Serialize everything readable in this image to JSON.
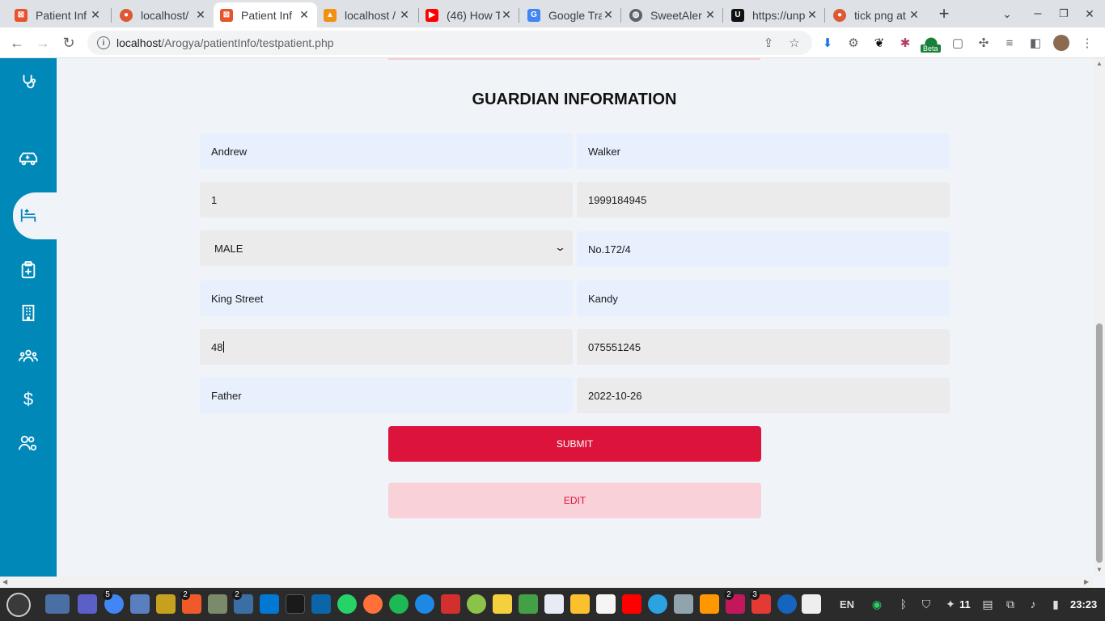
{
  "browser": {
    "tabs": [
      {
        "title": "Patient Inf",
        "favicon_color": "#e8532c"
      },
      {
        "title": "localhost/",
        "favicon_color": "#de5833"
      },
      {
        "title": "Patient Inf",
        "favicon_color": "#e8532c",
        "active": true
      },
      {
        "title": "localhost /",
        "favicon_color": "#f29111"
      },
      {
        "title": "(46) How T",
        "favicon_color": "#ff0000"
      },
      {
        "title": "Google Tra",
        "favicon_color": "#4285f4"
      },
      {
        "title": "SweetAler",
        "favicon_color": "#5f6368"
      },
      {
        "title": "https://unp",
        "favicon_color": "#111111"
      },
      {
        "title": "tick png at",
        "favicon_color": "#de5833"
      }
    ],
    "url_host": "localhost",
    "url_path": "/Arogya/patientInfo/testpatient.php",
    "beta_badge": "Beta"
  },
  "page": {
    "title": "GUARDIAN INFORMATION",
    "fields": {
      "first_name": "Andrew",
      "last_name": "Walker",
      "title_num": "1",
      "nic": "1999184945",
      "gender": "MALE",
      "address_no": "No.172/4",
      "street": "King Street",
      "city": "Kandy",
      "age": "48",
      "phone": "075551245",
      "relationship": "Father",
      "date": "2022-10-26"
    },
    "submit_label": "SUBMIT",
    "edit_label": "EDIT"
  },
  "taskbar": {
    "lang": "EN",
    "clock": "23:23",
    "volume": "11",
    "badges": {
      "chrome": "5",
      "brave": "2",
      "files": "2",
      "photos": "2",
      "glasses": "3"
    }
  },
  "colors": {
    "sidebar": "#0088b8",
    "submit": "#dc143c",
    "edit_bg": "#f8d1d9",
    "field_blue": "#e8f0fe",
    "field_grey": "#ebebeb"
  }
}
